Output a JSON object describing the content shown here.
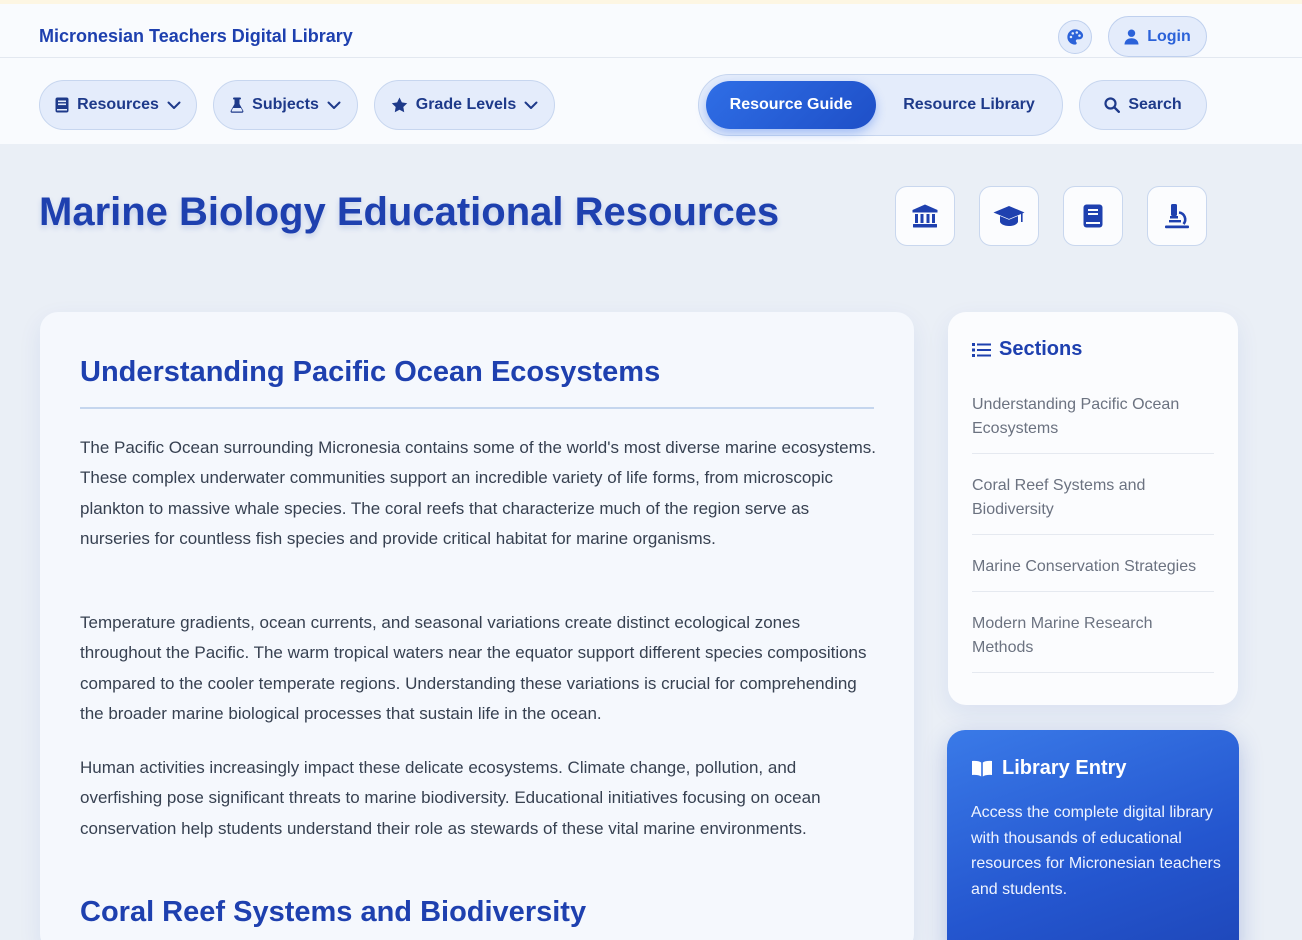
{
  "header": {
    "brand": "Micronesian Teachers Digital Library",
    "login_label": "Login",
    "icons": {
      "theme": "palette-icon",
      "login": "user-icon"
    }
  },
  "nav": {
    "dropdowns": [
      {
        "label": "Resources",
        "icon": "book-icon"
      },
      {
        "label": "Subjects",
        "icon": "flask-icon"
      },
      {
        "label": "Grade Levels",
        "icon": "star-icon"
      }
    ],
    "toggle": {
      "active": "Resource Guide",
      "inactive": "Resource Library"
    },
    "search_label": "Search"
  },
  "hero": {
    "title": "Marine Biology Educational Resources",
    "icons": [
      "institution-icon",
      "graduation-cap-icon",
      "book-icon",
      "microscope-icon"
    ]
  },
  "article": {
    "section1_heading": "Understanding Pacific Ocean Ecosystems",
    "paragraphs": [
      "The Pacific Ocean surrounding Micronesia contains some of the world's most diverse marine ecosystems. These complex underwater communities support an incredible variety of life forms, from microscopic plankton to massive whale species. The coral reefs that characterize much of the region serve as nurseries for countless fish species and provide critical habitat for marine organisms.",
      "Temperature gradients, ocean currents, and seasonal variations create distinct ecological zones throughout the Pacific. The warm tropical waters near the equator support different species compositions compared to the cooler temperate regions. Understanding these variations is crucial for comprehending the broader marine biological processes that sustain life in the ocean.",
      "Human activities increasingly impact these delicate ecosystems. Climate change, pollution, and overfishing pose significant threats to marine biodiversity. Educational initiatives focusing on ocean conservation help students understand their role as stewards of these vital marine environments."
    ],
    "section2_heading": "Coral Reef Systems and Biodiversity"
  },
  "sidebar": {
    "sections_title": "Sections",
    "items": [
      "Understanding Pacific Ocean Ecosystems",
      "Coral Reef Systems and Biodiversity",
      "Marine Conservation Strategies",
      "Modern Marine Research Methods"
    ],
    "library": {
      "title": "Library Entry",
      "text": "Access the complete digital library with thousands of educational resources for Micronesian teachers and students."
    }
  },
  "colors": {
    "brand": "#1e40af",
    "accent": "#2563eb",
    "pill_bg": "#e4ecfb",
    "page_bg": "#eaeff6"
  }
}
